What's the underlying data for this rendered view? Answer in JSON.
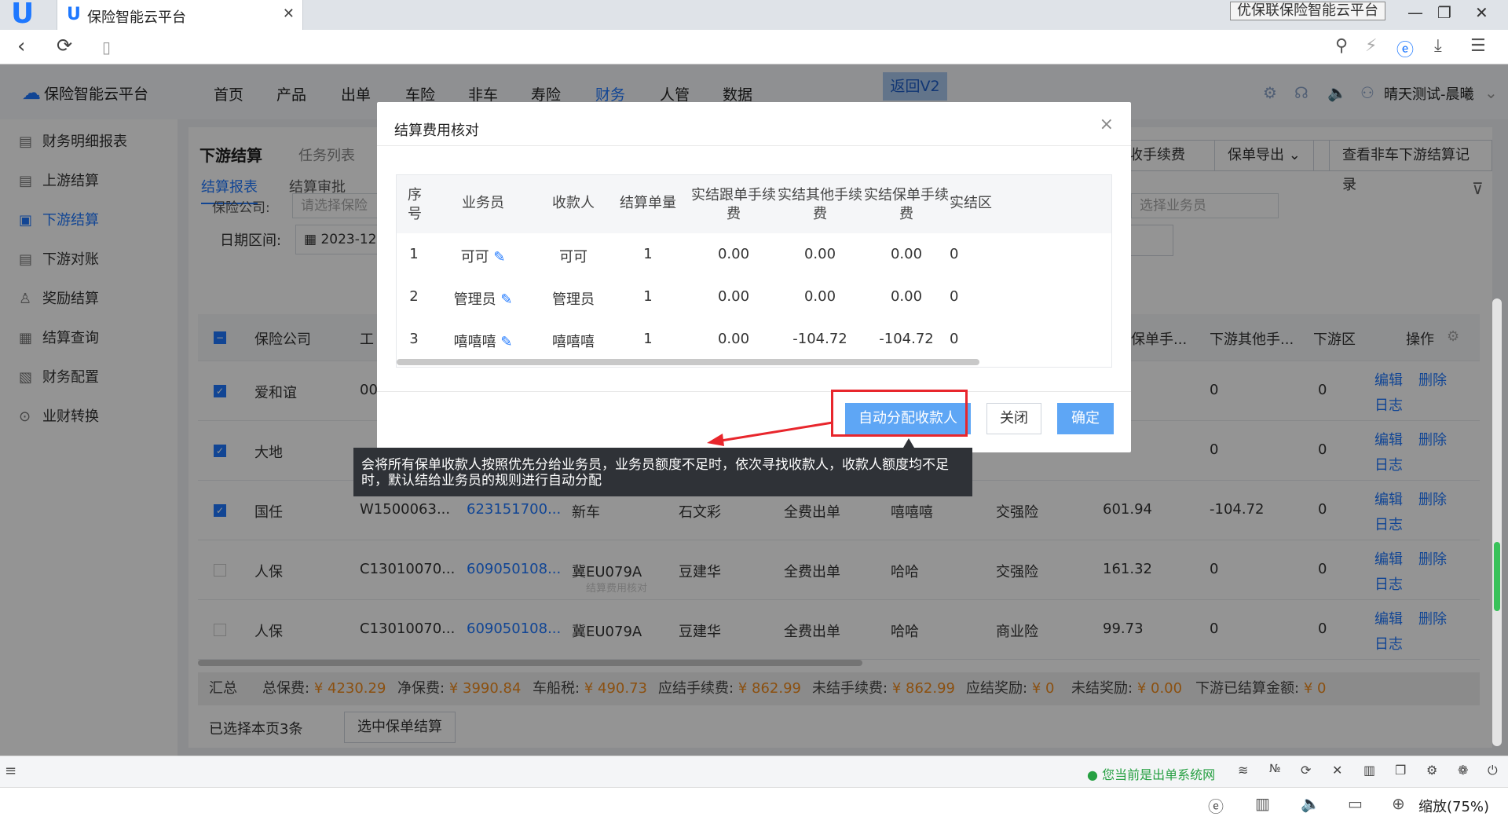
{
  "browser": {
    "tab_title": "保险智能云平台",
    "window_title": "优保联保险智能云平台",
    "zoom_label": "缩放(75%)"
  },
  "header": {
    "brand": "保险智能云平台",
    "menu": [
      "首页",
      "产品",
      "出单",
      "车险",
      "非车",
      "寿险",
      "财务",
      "人管",
      "数据"
    ],
    "active_menu": "财务",
    "return_label": "返回V2",
    "user": "晴天测试-晨曦"
  },
  "sidebar": {
    "items": [
      {
        "label": "财务明细报表",
        "icon": "report-icon"
      },
      {
        "label": "上游结算",
        "icon": "document-icon"
      },
      {
        "label": "下游结算",
        "icon": "settlement-icon"
      },
      {
        "label": "下游对账",
        "icon": "reconcile-icon"
      },
      {
        "label": "奖励结算",
        "icon": "reward-icon"
      },
      {
        "label": "结算查询",
        "icon": "query-icon"
      },
      {
        "label": "财务配置",
        "icon": "config-icon"
      },
      {
        "label": "业财转换",
        "icon": "convert-icon"
      }
    ],
    "active": "下游结算"
  },
  "page": {
    "title": "下游结算",
    "task_list": "任务列表",
    "fee_btn": "收手续费",
    "export_btn": "保单导出",
    "view_records_btn": "查看非车下游结算记录",
    "tabs": [
      "结算报表",
      "结算审批"
    ],
    "filter_company_label": "保险公司:",
    "filter_company_placeholder": "请选择保险",
    "filter_date_label": "日期区间:",
    "filter_date_value": "2023-12至",
    "salesman_placeholder": "选择业务员"
  },
  "table": {
    "headers": [
      "保险公司",
      "工",
      "保单手...",
      "下游其他手...",
      "下游区",
      "操作"
    ],
    "rows": [
      {
        "checked": true,
        "company": "爱和谊",
        "c2": "00",
        "c3": "",
        "c4": "",
        "c5": "",
        "c6": "",
        "c7": "",
        "c8": "",
        "c9": "",
        "c10": "0",
        "c11": "0"
      },
      {
        "checked": true,
        "company": "大地",
        "c2": "",
        "c3": "",
        "c4": "",
        "c5": "",
        "c6": "",
        "c7": "",
        "c8": "",
        "c9": "",
        "c10": "0",
        "c11": "0"
      },
      {
        "checked": true,
        "company": "国任",
        "c2": "W1500063...",
        "c3": "623151700...",
        "c4": "新车",
        "c5": "石文彩",
        "c6": "全费出单",
        "c7": "嘻嘻嘻",
        "c8": "交强险",
        "c9": "601.94",
        "c10": "-104.72",
        "c11": "0"
      },
      {
        "checked": false,
        "company": "人保",
        "c2": "C13010070...",
        "c3": "609050108...",
        "c4": "冀EU079A",
        "c5": "豆建华",
        "c6": "全费出单",
        "c7": "哈哈",
        "c8": "交强险",
        "c9": "161.32",
        "c10": "0",
        "c11": "0"
      },
      {
        "checked": false,
        "company": "人保",
        "c2": "C13010070...",
        "c3": "609050108...",
        "c4": "冀EU079A",
        "c5": "豆建华",
        "c6": "全费出单",
        "c7": "哈哈",
        "c8": "商业险",
        "c9": "99.73",
        "c10": "0",
        "c11": "0"
      }
    ],
    "op_edit": "编辑",
    "op_delete": "删除",
    "op_log": "日志",
    "faded_text": "结算费用核对"
  },
  "summary": {
    "label": "汇总",
    "items": [
      {
        "label": "总保费:",
        "value": "¥ 4230.29"
      },
      {
        "label": "净保费:",
        "value": "¥ 3990.84"
      },
      {
        "label": "车船税:",
        "value": "¥ 490.73"
      },
      {
        "label": "应结手续费:",
        "value": "¥ 862.99"
      },
      {
        "label": "未结手续费:",
        "value": "¥ 862.99"
      },
      {
        "label": "应结奖励:",
        "value": "¥ 0"
      },
      {
        "label": "未结奖励:",
        "value": "¥ 0.00"
      },
      {
        "label": "下游已结算金额:",
        "value": "¥ 0"
      }
    ],
    "selected_text": "已选择本页3条",
    "settle_btn": "选中保单结算"
  },
  "modal": {
    "title": "结算费用核对",
    "headers": [
      "序号",
      "业务员",
      "收款人",
      "结算单量",
      "实结跟单手续费",
      "实结其他手续费",
      "实结保单手续费",
      "实结区"
    ],
    "rows": [
      {
        "no": "1",
        "salesman": "可可",
        "payee": "可可",
        "count": "1",
        "f1": "0.00",
        "f2": "0.00",
        "f3": "0.00",
        "f4": "0"
      },
      {
        "no": "2",
        "salesman": "管理员",
        "payee": "管理员",
        "count": "1",
        "f1": "0.00",
        "f2": "0.00",
        "f3": "0.00",
        "f4": "0"
      },
      {
        "no": "3",
        "salesman": "嘻嘻嘻",
        "payee": "嘻嘻嘻",
        "count": "1",
        "f1": "0.00",
        "f2": "-104.72",
        "f3": "-104.72",
        "f4": "0"
      }
    ],
    "btn_auto": "自动分配收款人",
    "btn_close": "关闭",
    "btn_ok": "确定",
    "tooltip": "会将所有保单收款人按照优先分给业务员，业务员额度不足时，依次寻找收款人，收款人额度均不足时，默认结给业务员的规则进行自动分配"
  },
  "statusbar": {
    "status_text": "您当前是出单系统网"
  },
  "colors": {
    "accent": "#1e78ff",
    "highlight": "#e8262c",
    "amount": "#f08a1c"
  }
}
